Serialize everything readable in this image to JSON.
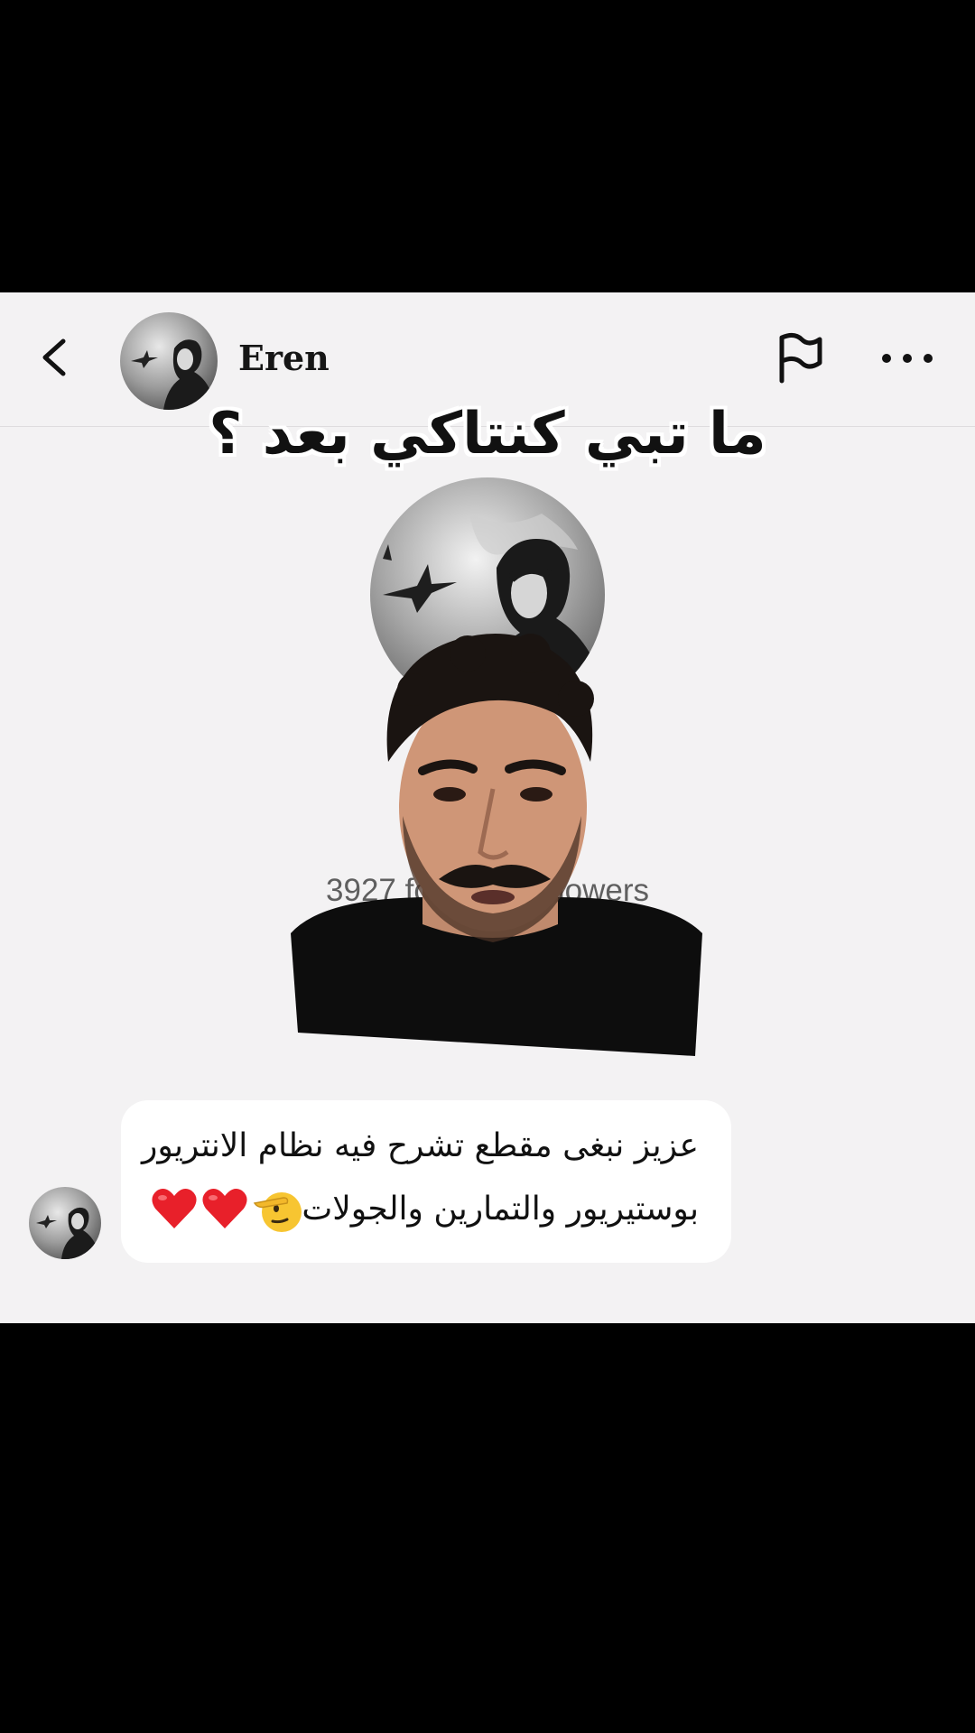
{
  "header": {
    "username": "Eren",
    "back_icon": "chevron-left-icon",
    "flag_icon": "flag-icon",
    "more_icon": "more-horizontal-icon"
  },
  "caption": "ما تبي كنتاكي بعد ؟",
  "profile": {
    "followers_text": "3927 follow            K followers"
  },
  "message": {
    "line1": "عزيز نبغى مقطع تشرح فيه نظام الانتريور",
    "line2": "بوستيريور والتمارين والجولات",
    "emojis": [
      "saluting-face",
      "heart",
      "heart"
    ]
  },
  "colors": {
    "panel_bg": "#f3f2f3",
    "bubble_bg": "#ffffff",
    "heart": "#e8202a"
  }
}
